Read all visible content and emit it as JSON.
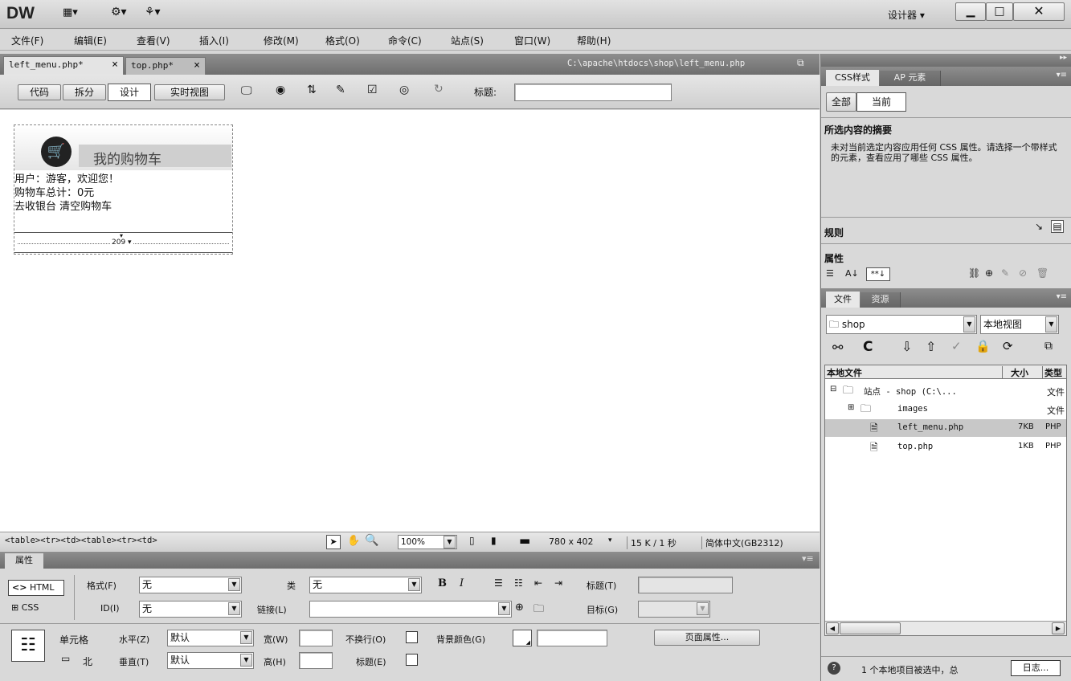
{
  "app": {
    "logo": "DW",
    "workspace": "设计器",
    "workspace_arrow": "▾"
  },
  "menu": [
    "文件(F)",
    "编辑(E)",
    "查看(V)",
    "插入(I)",
    "修改(M)",
    "格式(O)",
    "命令(C)",
    "站点(S)",
    "窗口(W)",
    "帮助(H)"
  ],
  "doc_tabs": [
    {
      "label": "left_menu.php*",
      "close": "×"
    },
    {
      "label": "top.php*",
      "close": "×"
    }
  ],
  "doc_path": "C:\\apache\\htdocs\\shop\\left_menu.php",
  "view_buttons": [
    "代码",
    "拆分",
    "设计",
    "实时视图"
  ],
  "title_label": "标题:",
  "title_value": "",
  "design": {
    "cart_title": "我的购物车",
    "line1": "用户：游客，欢迎您！",
    "line2": "购物车总计：0元",
    "line3": "去收银台 清空购物车",
    "width_indicator": "209 ▾"
  },
  "statusbar": {
    "tags": "<table><tr><td><table><tr><td>",
    "zoom": "100%",
    "size": "780 x 402",
    "dl": "15 K / 1 秒",
    "encoding": "简体中文(GB2312)"
  },
  "properties": {
    "panel_title": "属性",
    "html_btn": "HTML",
    "css_btn": "CSS",
    "format_label": "格式(F)",
    "format_value": "无",
    "class_label": "类",
    "class_value": "无",
    "bold": "B",
    "italic": "I",
    "title_label": "标题(T)",
    "id_label": "ID(I)",
    "id_value": "无",
    "link_label": "链接(L)",
    "target_label": "目标(G)",
    "cell_label": "单元格",
    "horiz_label": "水平(Z)",
    "horiz_value": "默认",
    "vert_label": "垂直(T)",
    "vert_value": "默认",
    "width_label": "宽(W)",
    "height_label": "高(H)",
    "nowrap_label": "不换行(O)",
    "header_label": "标题(E)",
    "bg_label": "背景颜色(G)",
    "page_props": "页面属性...",
    "merge_label": "北"
  },
  "css_panel": {
    "tabs": [
      "CSS样式",
      "AP 元素"
    ],
    "mode_buttons": [
      "全部",
      "当前"
    ],
    "summary_title": "所选内容的摘要",
    "summary_text": "未对当前选定内容应用任何 CSS 属性。请选择一个带样式的元素，查看应用了哪些 CSS 属性。",
    "rules_label": "规则",
    "props_label": "属性"
  },
  "files_panel": {
    "tabs": [
      "文件",
      "资源"
    ],
    "site": "shop",
    "view": "本地视图",
    "col_local": "本地文件",
    "col_size": "大小",
    "col_type": "类型",
    "rows": [
      {
        "name": "站点 - shop (C:\\...",
        "size": "",
        "type": "文件"
      },
      {
        "name": "images",
        "size": "",
        "type": "文件"
      },
      {
        "name": "left_menu.php",
        "size": "7KB",
        "type": "PHP"
      },
      {
        "name": "top.php",
        "size": "1KB",
        "type": "PHP"
      }
    ],
    "status": "1 个本地项目被选中，总",
    "log_btn": "日志..."
  }
}
